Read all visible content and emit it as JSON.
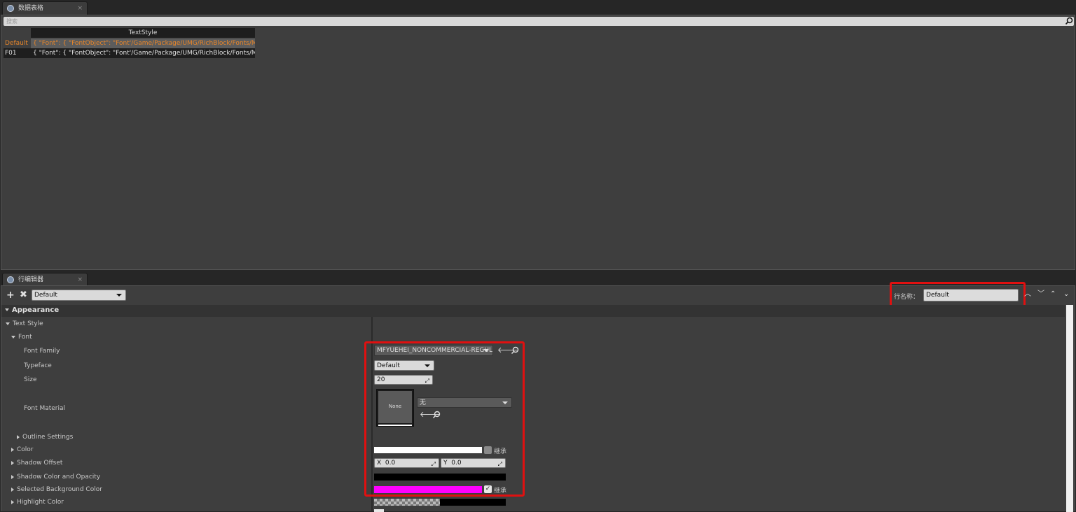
{
  "top_tab": {
    "label": "数据表格",
    "close": "×"
  },
  "search": {
    "placeholder": "搜索"
  },
  "table": {
    "column_header": "TextStyle",
    "rows": [
      {
        "name": "Default",
        "value": "{ \"Font\": { \"FontObject\": \"Font'/Game/Package/UMG/RichBlock/Fonts/MF"
      },
      {
        "name": "F01",
        "value": "{ \"Font\": { \"FontObject\": \"Font'/Game/Package/UMG/RichBlock/Fonts/MF"
      }
    ]
  },
  "bottom_tab": {
    "label": "行编辑器",
    "close": "×"
  },
  "toolbar": {
    "add_icon": "plus-icon",
    "remove_icon": "x-icon",
    "row_selector_value": "Default",
    "row_name_label": "行名称：",
    "row_name_value": "Default"
  },
  "categories": {
    "appearance": "Appearance",
    "text_style": "Text Style",
    "font": "Font"
  },
  "properties": {
    "font_family": {
      "label": "Font Family",
      "value": "MFYUEHEI_NONCOMMERCIAL-REGULA"
    },
    "typeface": {
      "label": "Typeface",
      "value": "Default"
    },
    "size": {
      "label": "Size",
      "value": "20"
    },
    "font_material": {
      "label": "Font Material",
      "thumb_text": "None",
      "value": "无"
    },
    "outline_settings": {
      "label": "Outline Settings"
    },
    "color": {
      "label": "Color",
      "inherit_label": "继承",
      "swatch": "#ffffff"
    },
    "shadow_offset": {
      "label": "Shadow Offset",
      "x_label": "X",
      "x_value": "0.0",
      "y_label": "Y",
      "y_value": "0.0"
    },
    "shadow_color": {
      "label": "Shadow Color and Opacity",
      "swatch": "#000000"
    },
    "selected_bg": {
      "label": "Selected Background Color",
      "inherit_label": "继承",
      "swatch": "#ff00ff"
    },
    "highlight": {
      "label": "Highlight Color"
    }
  },
  "colors": {
    "selected_row_text": "#e8862a",
    "highlight_box": "#e01010"
  }
}
